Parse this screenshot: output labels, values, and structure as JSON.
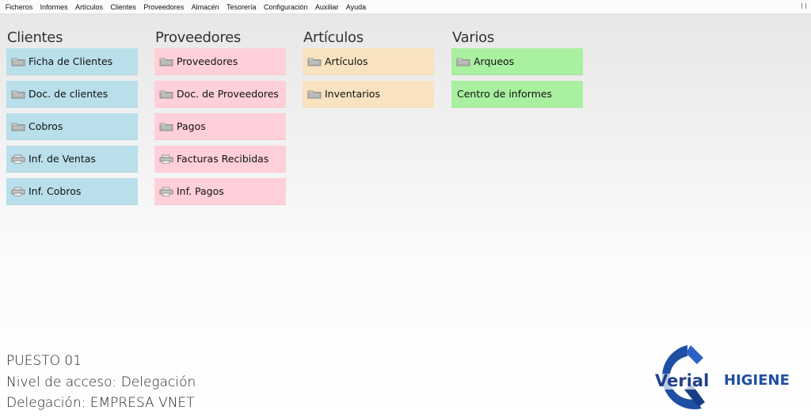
{
  "menu": [
    "Ficheros",
    "Informes",
    "Artículos",
    "Clientes",
    "Proveedores",
    "Almacén",
    "Tesorería",
    "Configuración",
    "Auxiliar",
    "Ayuda"
  ],
  "columns": [
    {
      "title": "Clientes",
      "color": "#b9dfea",
      "tiles": [
        {
          "label": "Ficha de Clientes",
          "icon": "folder-icon"
        },
        {
          "label": "Doc. de clientes",
          "icon": "folder-icon"
        },
        {
          "label": "Cobros",
          "icon": "folder-icon"
        },
        {
          "label": "Inf. de Ventas",
          "icon": "printer-icon"
        },
        {
          "label": "Inf. Cobros",
          "icon": "printer-icon"
        }
      ]
    },
    {
      "title": "Proveedores",
      "color": "#ffd0d9",
      "tiles": [
        {
          "label": "Proveedores",
          "icon": "folder-icon"
        },
        {
          "label": "Doc. de Proveedores",
          "icon": "folder-icon"
        },
        {
          "label": "Pagos",
          "icon": "folder-icon"
        },
        {
          "label": "Facturas Recibidas",
          "icon": "printer-icon"
        },
        {
          "label": "Inf. Pagos",
          "icon": "printer-icon"
        }
      ]
    },
    {
      "title": "Artículos",
      "color": "#f9e2bf",
      "tiles": [
        {
          "label": "Artículos",
          "icon": "folder-icon"
        },
        {
          "label": "Inventarios",
          "icon": "folder-icon"
        }
      ]
    },
    {
      "title": "Varios",
      "color": "#a9f0a0",
      "tiles": [
        {
          "label": "Arqueos",
          "icon": "folder-icon"
        },
        {
          "label": "Centro de informes",
          "icon": ""
        }
      ]
    }
  ],
  "status": {
    "station": "PUESTO 01",
    "access_level": "Nivel de acceso: Delegación",
    "delegation": "Delegación: EMPRESA VNET"
  },
  "logo": {
    "brand": "Verial",
    "product": "HIGIENE",
    "primary_color": "#1f4fa3"
  }
}
